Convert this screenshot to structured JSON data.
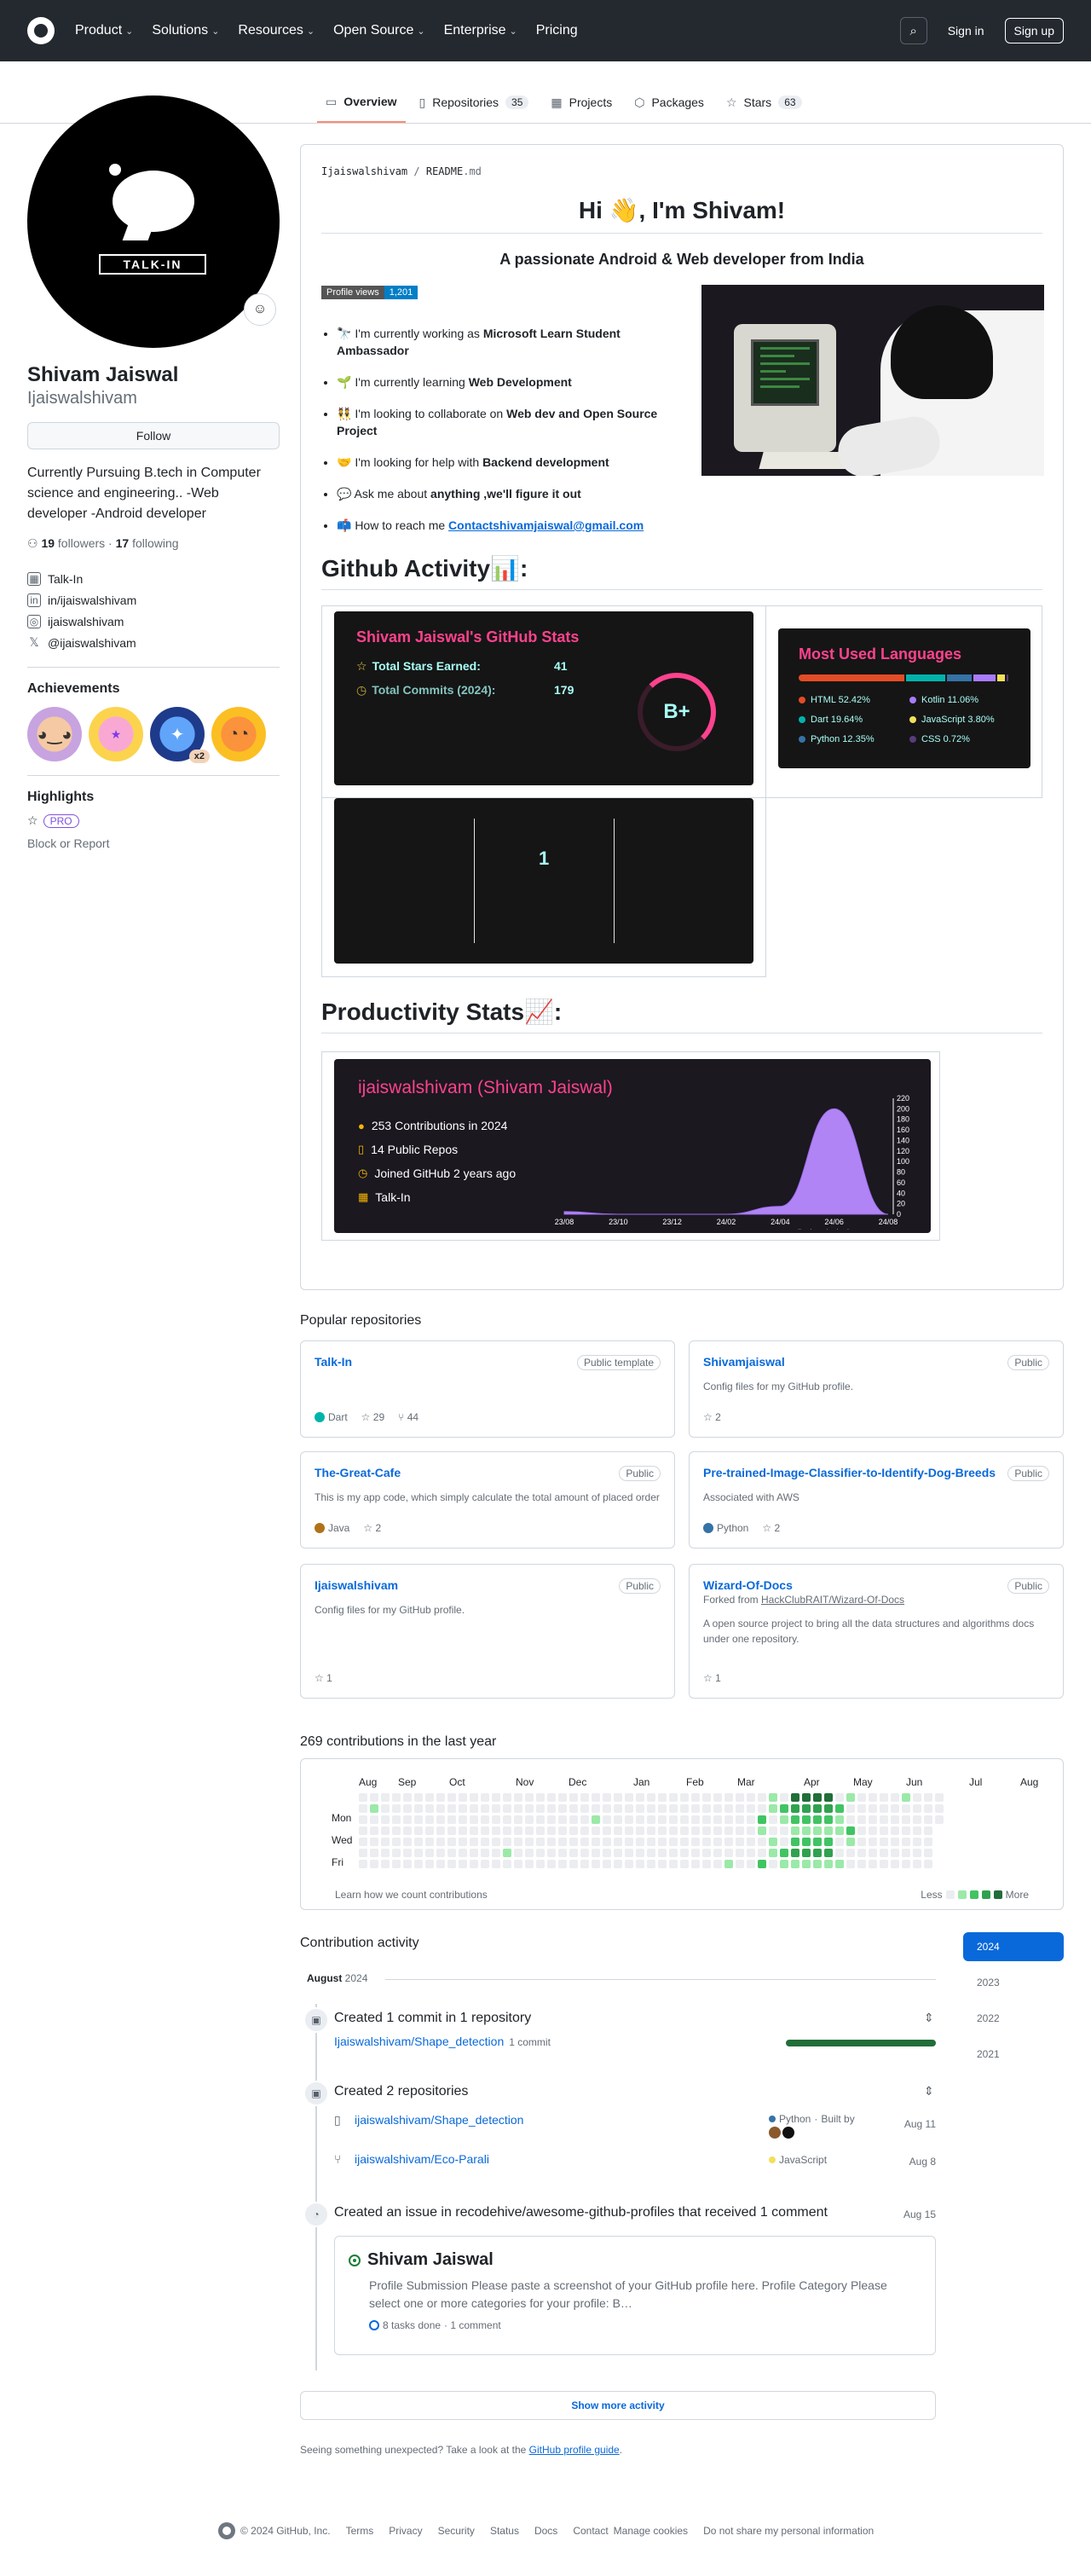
{
  "header": {
    "nav": [
      "Product",
      "Solutions",
      "Resources",
      "Open Source",
      "Enterprise",
      "Pricing"
    ],
    "sign_in": "Sign in",
    "sign_up": "Sign up"
  },
  "tabs": [
    {
      "label": "Overview",
      "count": "",
      "icon": "book-icon"
    },
    {
      "label": "Repositories",
      "count": "35",
      "icon": "repo-icon"
    },
    {
      "label": "Projects",
      "count": "",
      "icon": "table-icon"
    },
    {
      "label": "Packages",
      "count": "",
      "icon": "package-icon"
    },
    {
      "label": "Stars",
      "count": "63",
      "icon": "star-icon"
    }
  ],
  "profile": {
    "avatar_text": "TALK-IN",
    "full_name": "Shivam Jaiswal",
    "username": "Ijaiswalshivam",
    "follow": "Follow",
    "bio": "Currently Pursuing B.tech in Computer science and engineering.. -Web developer -Android developer",
    "followers_count": "19",
    "followers_label": "followers",
    "following_count": "17",
    "following_label": "following",
    "links": [
      {
        "text": "Talk-In",
        "icon": "organization-icon"
      },
      {
        "text": "in/ijaiswalshivam",
        "icon": "linkedin-icon"
      },
      {
        "text": "ijaiswalshivam",
        "icon": "instagram-icon"
      },
      {
        "text": "@ijaiswalshivam",
        "icon": "x-icon"
      }
    ],
    "achievements_title": "Achievements",
    "badge_multiplier": "x2",
    "highlights_title": "Highlights",
    "pro": "PRO",
    "block": "Block or Report"
  },
  "readme": {
    "path_user": "Ijaiswalshivam",
    "path_sep": "/",
    "path_file": "README",
    "path_ext": ".md",
    "h1": "Hi 👋, I'm Shivam!",
    "h3": "A passionate Android & Web developer from India",
    "views_label": "Profile views",
    "views_value": "1,201",
    "bullets": [
      {
        "pre": "🔭 I'm currently working as ",
        "bold": "Microsoft Learn Student Ambassador",
        "post": ""
      },
      {
        "pre": "🌱 I'm currently learning ",
        "bold": "Web Development",
        "post": ""
      },
      {
        "pre": "👯 I'm looking to collaborate on ",
        "bold": "Web dev and Open Source Project",
        "post": ""
      },
      {
        "pre": "🤝 I'm looking for help with ",
        "bold": "Backend development",
        "post": ""
      },
      {
        "pre": "💬 Ask me about ",
        "bold": "anything ,we'll figure it out",
        "post": ""
      },
      {
        "pre": "📫 How to reach me ",
        "bold": "Contactshivamjaiswal@gmail.com",
        "post": ""
      }
    ],
    "github_activity": "Github Activity📊:",
    "productivity": "Productivity Stats📈:"
  },
  "stats_card": {
    "title": "Shivam Jaiswal's GitHub Stats",
    "stars_label": "Total Stars Earned:",
    "stars_value": "41",
    "commits_label": "Total Commits (2024):",
    "commits_value": "179",
    "grade": "B+"
  },
  "languages": {
    "title": "Most Used Languages",
    "items": [
      {
        "name": "HTML",
        "pct": 52.42,
        "label": "HTML 52.42%",
        "color": "#e34c26"
      },
      {
        "name": "Kotlin",
        "pct": 11.06,
        "label": "Kotlin 11.06%",
        "color": "#a97bff"
      },
      {
        "name": "Dart",
        "pct": 19.64,
        "label": "Dart 19.64%",
        "color": "#00b4ab"
      },
      {
        "name": "JavaScript",
        "pct": 3.8,
        "label": "JavaScript 3.80%",
        "color": "#f1e05a"
      },
      {
        "name": "Python",
        "pct": 12.35,
        "label": "Python 12.35%",
        "color": "#3572a5"
      },
      {
        "name": "CSS",
        "pct": 0.72,
        "label": "CSS 0.72%",
        "color": "#563d7c"
      }
    ]
  },
  "streak": {
    "value": "1"
  },
  "productivity_card": {
    "title": "ijaiswalshivam (Shivam Jaiswal)",
    "rows": [
      "253 Contributions in 2024",
      "14 Public Repos",
      "Joined GitHub 2 years ago",
      "Talk-In"
    ],
    "row_icons": [
      "github-icon",
      "repo-icon",
      "clock-icon",
      "organization-icon"
    ],
    "x_labels": [
      "23/08",
      "23/10",
      "23/12",
      "24/02",
      "24/04",
      "24/06",
      "24/08"
    ],
    "y_labels": [
      "220",
      "200",
      "180",
      "160",
      "140",
      "120",
      "100",
      "80",
      "60",
      "40",
      "20",
      "0"
    ],
    "caption": "contributions in the last year"
  },
  "chart_data": {
    "type": "area",
    "title": "ijaiswalshivam (Shivam Jaiswal)",
    "xlabel": "contributions in the last year",
    "ylabel": "",
    "x": [
      "23/08",
      "23/10",
      "23/12",
      "24/02",
      "24/04",
      "24/06",
      "24/08"
    ],
    "ylim": [
      0,
      220
    ],
    "series": [
      {
        "values": [
          5,
          0,
          0,
          0,
          15,
          200,
          0
        ]
      }
    ]
  },
  "popular": {
    "title": "Popular repositories",
    "repos": [
      {
        "name": "Talk-In",
        "vis": "Public template",
        "desc": "",
        "fork": "",
        "lang": "Dart",
        "lang_color": "#00b4ab",
        "stars": "29",
        "forks": "44"
      },
      {
        "name": "Shivamjaiswal",
        "vis": "Public",
        "desc": "Config files for my GitHub profile.",
        "fork": "",
        "lang": "",
        "lang_color": "",
        "stars": "2",
        "forks": ""
      },
      {
        "name": "The-Great-Cafe",
        "vis": "Public",
        "desc": "This is my app code, which simply calculate the total amount of placed order",
        "fork": "",
        "lang": "Java",
        "lang_color": "#b07219",
        "stars": "2",
        "forks": ""
      },
      {
        "name": "Pre-trained-Image-Classifier-to-Identify-Dog-Breeds",
        "vis": "Public",
        "desc": "Associated with AWS",
        "fork": "",
        "lang": "Python",
        "lang_color": "#3572a5",
        "stars": "2",
        "forks": ""
      },
      {
        "name": "Ijaiswalshivam",
        "vis": "Public",
        "desc": "Config files for my GitHub profile.",
        "fork": "",
        "lang": "",
        "lang_color": "",
        "stars": "1",
        "forks": ""
      },
      {
        "name": "Wizard-Of-Docs",
        "vis": "Public",
        "desc": "A open source project to bring all the data structures and algorithms docs under one repository.",
        "fork_pre": "Forked from ",
        "fork": "HackClubRAIT/Wizard-Of-Docs",
        "lang": "",
        "lang_color": "",
        "stars": "1",
        "forks": ""
      }
    ]
  },
  "calendar": {
    "title": "269 contributions in the last year",
    "months": [
      "Aug",
      "Sep",
      "Oct",
      "Nov",
      "Dec",
      "Jan",
      "Feb",
      "Mar",
      "Apr",
      "May",
      "Jun",
      "Jul",
      "Aug"
    ],
    "days": [
      "Mon",
      "Wed",
      "Fri"
    ],
    "learn": "Learn how we count contributions",
    "less": "Less",
    "more": "More",
    "colors": [
      "#ebedf0",
      "#9be9a8",
      "#40c463",
      "#30a14e",
      "#216e39"
    ]
  },
  "activity": {
    "title": "Contribution activity",
    "years": [
      "2024",
      "2023",
      "2022",
      "2021"
    ],
    "month": "August",
    "month_year": "2024",
    "commits_title": "Created 1 commit in 1 repository",
    "commit_repo": "Ijaiswalshivam/Shape_detection",
    "commit_count": "1 commit",
    "repos_title": "Created 2 repositories",
    "created": [
      {
        "name": "ijaiswalshivam/Shape_detection",
        "lang": "Python",
        "lang_color": "#3572a5",
        "built_by": "Built by",
        "date": "Aug 11"
      },
      {
        "name": "ijaiswalshivam/Eco-Parali",
        "lang": "JavaScript",
        "lang_color": "#f1e05a",
        "built_by": "",
        "date": "Aug 8"
      }
    ],
    "issue_title": "Created an issue in recodehive/awesome-github-profiles that received 1 comment",
    "issue_date": "Aug 15",
    "issue_heading": "Shivam Jaiswal",
    "issue_body": "Profile Submission Please paste a screenshot of your GitHub profile here. Profile Category Please select one or more categories for your profile: B…",
    "issue_tasks": "8 tasks done",
    "issue_comments": "· 1 comment",
    "show_more": "Show more activity",
    "unexpected_pre": "Seeing something unexpected? Take a look at the ",
    "unexpected_link": "GitHub profile guide",
    "unexpected_post": "."
  },
  "footer": {
    "items": [
      "© 2024 GitHub, Inc.",
      "Terms",
      "Privacy",
      "Security",
      "Status",
      "Docs",
      "Contact",
      "Manage cookies",
      "Do not share my personal information"
    ]
  }
}
